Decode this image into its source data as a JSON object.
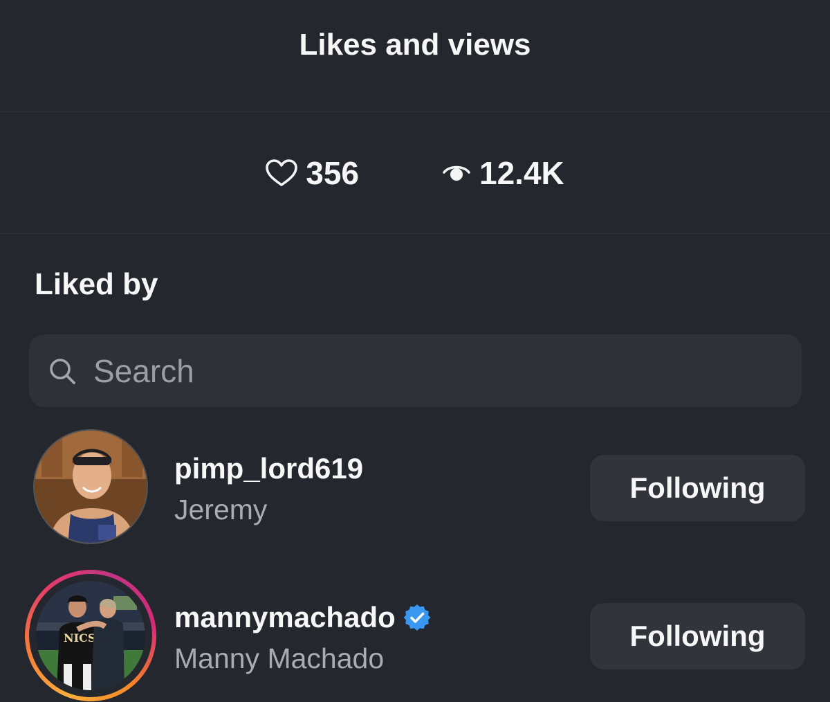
{
  "header": {
    "title": "Likes and views"
  },
  "stats": {
    "likes": {
      "icon": "heart-icon",
      "value": "356"
    },
    "views": {
      "icon": "eye-icon",
      "value": "12.4K"
    }
  },
  "section_title": "Liked by",
  "search": {
    "placeholder": "Search",
    "value": ""
  },
  "users": [
    {
      "username": "pimp_lord619",
      "full_name": "Jeremy",
      "verified": false,
      "story_ring": false,
      "button_label": "Following"
    },
    {
      "username": "mannymachado",
      "full_name": "Manny Machado",
      "verified": true,
      "story_ring": true,
      "button_label": "Following"
    }
  ],
  "colors": {
    "background": "#24272d",
    "search_bg": "#2e3138",
    "button_bg": "#31343b",
    "verified_badge": "#3897f0"
  }
}
